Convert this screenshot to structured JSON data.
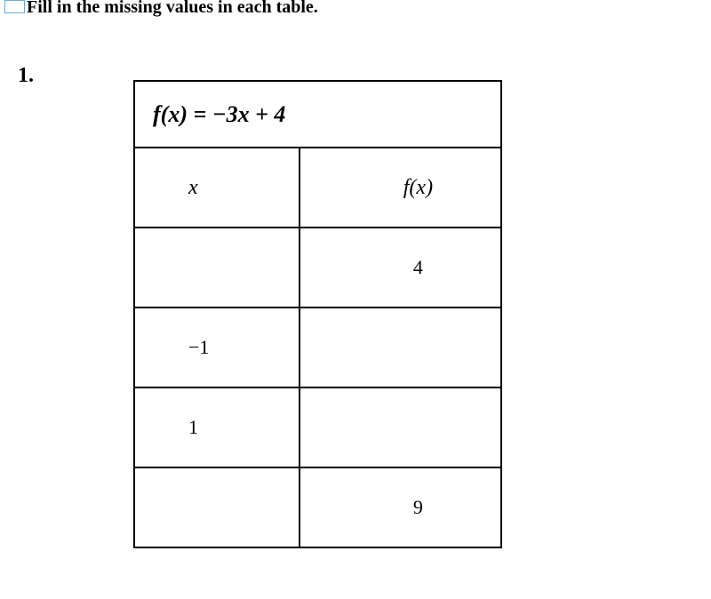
{
  "instruction": "Fill in the missing values in each table.",
  "problem_number": "1.",
  "formula": "f(x) = −3x + 4",
  "headers": {
    "x": "x",
    "fx": "f(x)"
  },
  "rows": [
    {
      "x": "",
      "fx": "4"
    },
    {
      "x": "−1",
      "fx": ""
    },
    {
      "x": "1",
      "fx": ""
    },
    {
      "x": "",
      "fx": "9"
    }
  ]
}
